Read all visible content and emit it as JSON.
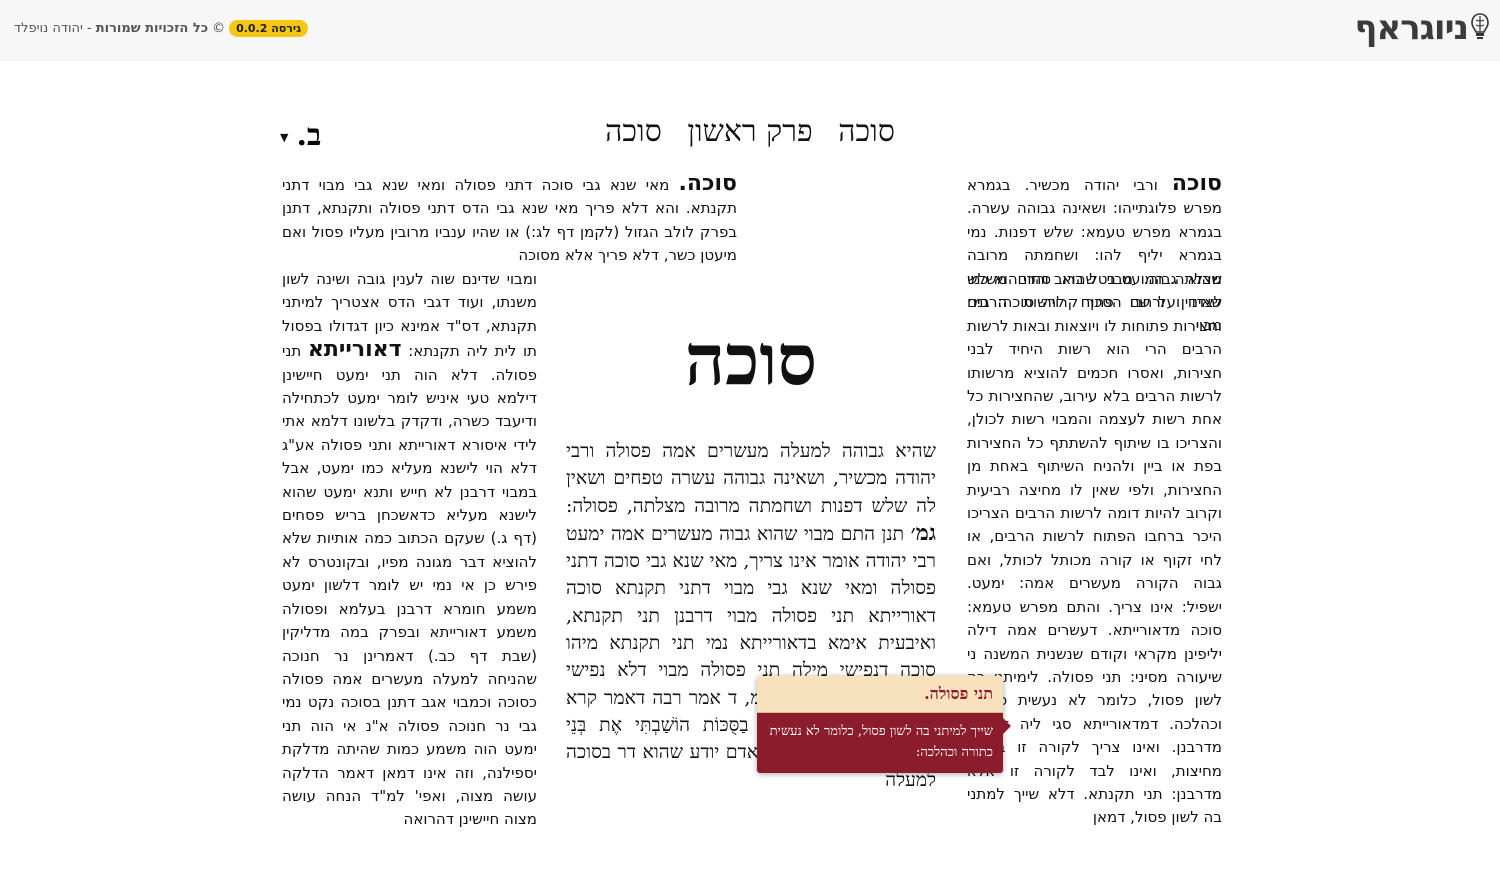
{
  "app": {
    "logo_text": "ניוגראף",
    "version": "גירסה 0.0.2",
    "copyright_symbol": "©",
    "rights_text": "כל הזכויות שמורות",
    "author_text": "- יהודה נויפלד"
  },
  "heading": {
    "tractate_left": "סוכה",
    "chapter": "פרק ראשון",
    "tractate_right": "סוכה",
    "daf": "ב."
  },
  "big_title": "סוכה",
  "rashi_top": {
    "dibur": "סוכה",
    "text": "ורבי יהודה מכשיר. בגמרא מפרש פלוגתייהו: ושאינה גבוהה עשרה. בגמרא מפרש טעמא: שלש דפנות. נמי בגמרא יליף להו: ושחמתה מרובה מצלתה. המועט בטל ברוב והרי הוא כמי שאינו ועל שם הסכך קרויה סוכה: גמ׳ מבוי"
  },
  "rashi_body": {
    "text": "שהוא גבוה. מבוי שהוא סתום משלש לצדדין ורחבו פתוח לרשות הרבים וחצירות פתוחות לו ויוצאות ובאות לרשות הרבים הרי הוא רשות היחיד לבני חצירות, ואסרו חכמים להוציא מרשותו לרשות הרבים בלא עירוב, שהחצירות כל אחת רשות לעצמה והמבוי רשות לכולן, והצריכו בו שיתוף להשתתף כל החצירות בפת או ביין ולהניח השיתוף באחת מן החצירות, ולפי שאין לו מחיצה רביעית וקרוב להיות דומה לרשות הרבים הצריכו היכר ברחבו הפתוח לרשות הרבים, או לחי זקוף או קורה מכותל לכותל, ואם גבוה הקורה מעשרים אמה: ימעט. ישפיל: אינו צריך. והתם מפרש טעמא: סוכה מדאורייתא. דעשרים אמה דילה יליפינן מקראי וקודם שנשנית המשנה ני שיעורה מסיני: תני פסולה. לימיתני בה לשון פסול, כלומר לא נעשית כתורה וכהלכה. דמדאורייתא סגי ליה דכוליה מדרבנן. ואינו צריך לקורה זו בשלש מחיצות, ואינו לבד לקורה זו אלא מדרבנן: תני תקנתא. דלא שייך למתני בה לשון פסול, דמאן"
  },
  "tosafot_top": {
    "dibur": "סוכה.",
    "text": "מאי שנא גבי סוכה דתני פסולה ומאי שנא גבי מבוי דתני תקנתא. והא דלא פריך מאי שנא גבי הדס דתני פסולה ותקנתא, דתנן בפרק לולב הגזול (לקמן דף לג:) או שהיו ענביו מרובין מעליו פסול ואם מיעטן כשר, דלא פריך אלא מסוכה"
  },
  "tosafot_body": {
    "pre": "ומבוי שדינם שוה לענין גובה ושינה לשון משנתו, ועוד דגבי הדס אצטריך למיתני תקנתא, דס\"ד אמינא כיון דגדולו בפסול תו לית ליה תקנתא:",
    "dibur": "דאורייתא",
    "mid": "תני פסולה. דלא הוה תני ימעט",
    "text": "חיישינן דילמא טעי איניש לומר ימעט לכתחילה ודיעבד כשרה, ודקדק בלשונו דלמא אתי לידי איסורא דאורייתא ותני פסולה אע\"ג דלא הוי לישנא מעליא כמו ימעט, אבל במבוי דרבנן לא חייש ותנא ימעט שהוא לישנא מעליא כדאשכחן בריש פסחים (דף ג.) שעקם הכתוב כמה אותיות שלא להוציא דבר מגונה מפיו, ובקונטרס לא פירש כן אי נמי יש לומר דלשון ימעט משמע חומרא דרבנן בעלמא ופסולה משמע דאורייתא ובפרק במה מדליקין (שבת דף כב.) דאמרינן נר חנוכה שהניחה למעלה מעשרים אמה פסולה כסוכה וכמבוי אגב דתנן בסוכה נקט נמי גבי נר חנוכה פסולה א\"נ אי הוה תני ימעט הוה משמע כמות שהיתה מדלקת יספילנה, וזה אינו דמאן דאמר הדלקה עושה מצוה, ואפי' למ\"ד הנחה עושה מצוה חיישינן דהרואה"
  },
  "gemara": {
    "pre": "שהיא גבוהה למעלה מעשרים אמה פסולה ורבי יהודה מכשיר, ושאינה גבוהה עשרה טפחים ושאין לה שלש דפנות ושחמתה מרובה מצלתה, פסולה:",
    "dibur": "גמ׳",
    "post": "תנן התם מבוי שהוא גבוה מעשרים אמה ימעט רבי יהודה אומר אינו צריך, מאי שנא גבי סוכה דתני פסולה ומאי שנא גבי מבוי דתני תקנתא סוכה דאורייתא תני פסולה מבוי דרבנן תני תקנתא, ואיבעית אימא בדאורייתא נמי תני תקנתא מיהו סוכה דנפישי מילה תני פסולה מבוי דלא נפישי מילה תני תקנתא. מנה\"מ, ד אמר רבה דאמר קרא לְמַעַן יֵדְעוּ דֹרֹתֵיכֶם כִּי בַסֻּכּוֹת הוֹשַׁבְתִּי אֶת בְּנֵי יִשְׂרָאֵל עד עשרים אמה אדם יודע שהוא דר בסוכה למעלה"
  },
  "popup": {
    "title": "תני פסולה.",
    "body": "שייך למיתני בה לשון פסול, כלומר לא נעשית כתורה וכהלכה:"
  }
}
